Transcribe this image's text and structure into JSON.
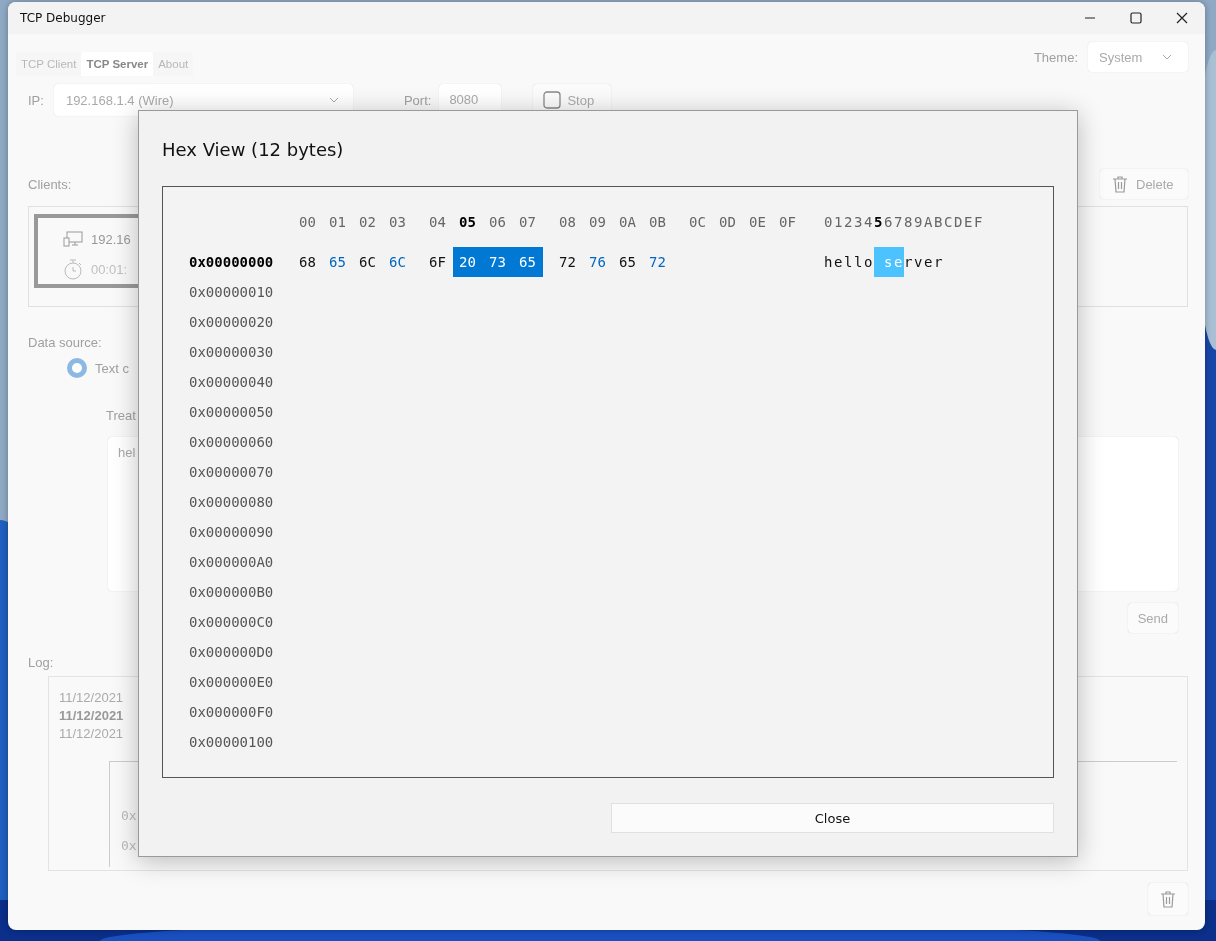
{
  "window": {
    "title": "TCP Debugger"
  },
  "tabs": [
    {
      "label": "TCP Client",
      "selected": false
    },
    {
      "label": "TCP Server",
      "selected": true
    },
    {
      "label": "About",
      "selected": false
    }
  ],
  "theme": {
    "label": "Theme:",
    "value": "System"
  },
  "server": {
    "ip_label": "IP:",
    "ip_value": "192.168.1.4 (Wire)",
    "port_label": "Port:",
    "port_value": "8080",
    "stop_button": "Stop"
  },
  "clients": {
    "label": "Clients:",
    "delete_button": "Delete",
    "items": [
      {
        "address": "192.16",
        "duration": "00:01:"
      }
    ]
  },
  "data_source": {
    "label": "Data source:",
    "options": [
      {
        "label": "Text c",
        "selected": true
      }
    ],
    "treat_label": "Treat",
    "text": "hel",
    "send_button": "Send"
  },
  "log": {
    "label": "Log:",
    "lines": [
      {
        "text": "11/12/2021",
        "bold": false
      },
      {
        "text": "11/12/2021",
        "bold": true
      },
      {
        "text": "11/12/2021",
        "bold": false
      }
    ],
    "hex_lines": [
      "0x",
      "0x"
    ]
  },
  "dialog": {
    "title": "Hex View (12 bytes)",
    "columns": [
      {
        "label": "00",
        "selected": false
      },
      {
        "label": "01",
        "selected": false
      },
      {
        "label": "02",
        "selected": false
      },
      {
        "label": "03",
        "selected": false
      },
      {
        "label": "04",
        "selected": false
      },
      {
        "label": "05",
        "selected": true
      },
      {
        "label": "06",
        "selected": false
      },
      {
        "label": "07",
        "selected": false
      },
      {
        "label": "08",
        "selected": false
      },
      {
        "label": "09",
        "selected": false
      },
      {
        "label": "0A",
        "selected": false
      },
      {
        "label": "0B",
        "selected": false
      },
      {
        "label": "0C",
        "selected": false
      },
      {
        "label": "0D",
        "selected": false
      },
      {
        "label": "0E",
        "selected": false
      },
      {
        "label": "0F",
        "selected": false
      }
    ],
    "ascii_header": [
      {
        "char": "0",
        "selected": false
      },
      {
        "char": "1",
        "selected": false
      },
      {
        "char": "2",
        "selected": false
      },
      {
        "char": "3",
        "selected": false
      },
      {
        "char": "4",
        "selected": false
      },
      {
        "char": "5",
        "selected": true
      },
      {
        "char": "6",
        "selected": false
      },
      {
        "char": "7",
        "selected": false
      },
      {
        "char": "8",
        "selected": false
      },
      {
        "char": "9",
        "selected": false
      },
      {
        "char": "A",
        "selected": false
      },
      {
        "char": "B",
        "selected": false
      },
      {
        "char": "C",
        "selected": false
      },
      {
        "char": "D",
        "selected": false
      },
      {
        "char": "E",
        "selected": false
      },
      {
        "char": "F",
        "selected": false
      }
    ],
    "rows": [
      {
        "offset": "0x00000000",
        "selected": true,
        "bytes": [
          {
            "hex": "68",
            "char": "h",
            "selected": false
          },
          {
            "hex": "65",
            "char": "e",
            "selected": false
          },
          {
            "hex": "6C",
            "char": "l",
            "selected": false
          },
          {
            "hex": "6C",
            "char": "l",
            "selected": false
          },
          {
            "hex": "6F",
            "char": "o",
            "selected": false
          },
          {
            "hex": "20",
            "selected": true
          },
          {
            "hex": "73",
            "char": "s",
            "selected": true
          },
          {
            "hex": "65",
            "char": "e",
            "selected": true
          },
          {
            "hex": "72",
            "char": "r",
            "selected": false
          },
          {
            "hex": "76",
            "char": "v",
            "selected": false
          },
          {
            "hex": "65",
            "char": "e",
            "selected": false
          },
          {
            "hex": "72",
            "char": "r",
            "selected": false
          }
        ]
      },
      {
        "offset": "0x00000010",
        "selected": false
      },
      {
        "offset": "0x00000020",
        "selected": false
      },
      {
        "offset": "0x00000030",
        "selected": false
      },
      {
        "offset": "0x00000040",
        "selected": false
      },
      {
        "offset": "0x00000050",
        "selected": false
      },
      {
        "offset": "0x00000060",
        "selected": false
      },
      {
        "offset": "0x00000070",
        "selected": false
      },
      {
        "offset": "0x00000080",
        "selected": false
      },
      {
        "offset": "0x00000090",
        "selected": false
      },
      {
        "offset": "0x000000A0",
        "selected": false
      },
      {
        "offset": "0x000000B0",
        "selected": false
      },
      {
        "offset": "0x000000C0",
        "selected": false
      },
      {
        "offset": "0x000000D0",
        "selected": false
      },
      {
        "offset": "0x000000E0",
        "selected": false
      },
      {
        "offset": "0x000000F0",
        "selected": false
      },
      {
        "offset": "0x00000100",
        "selected": false
      }
    ],
    "close_button": "Close"
  }
}
